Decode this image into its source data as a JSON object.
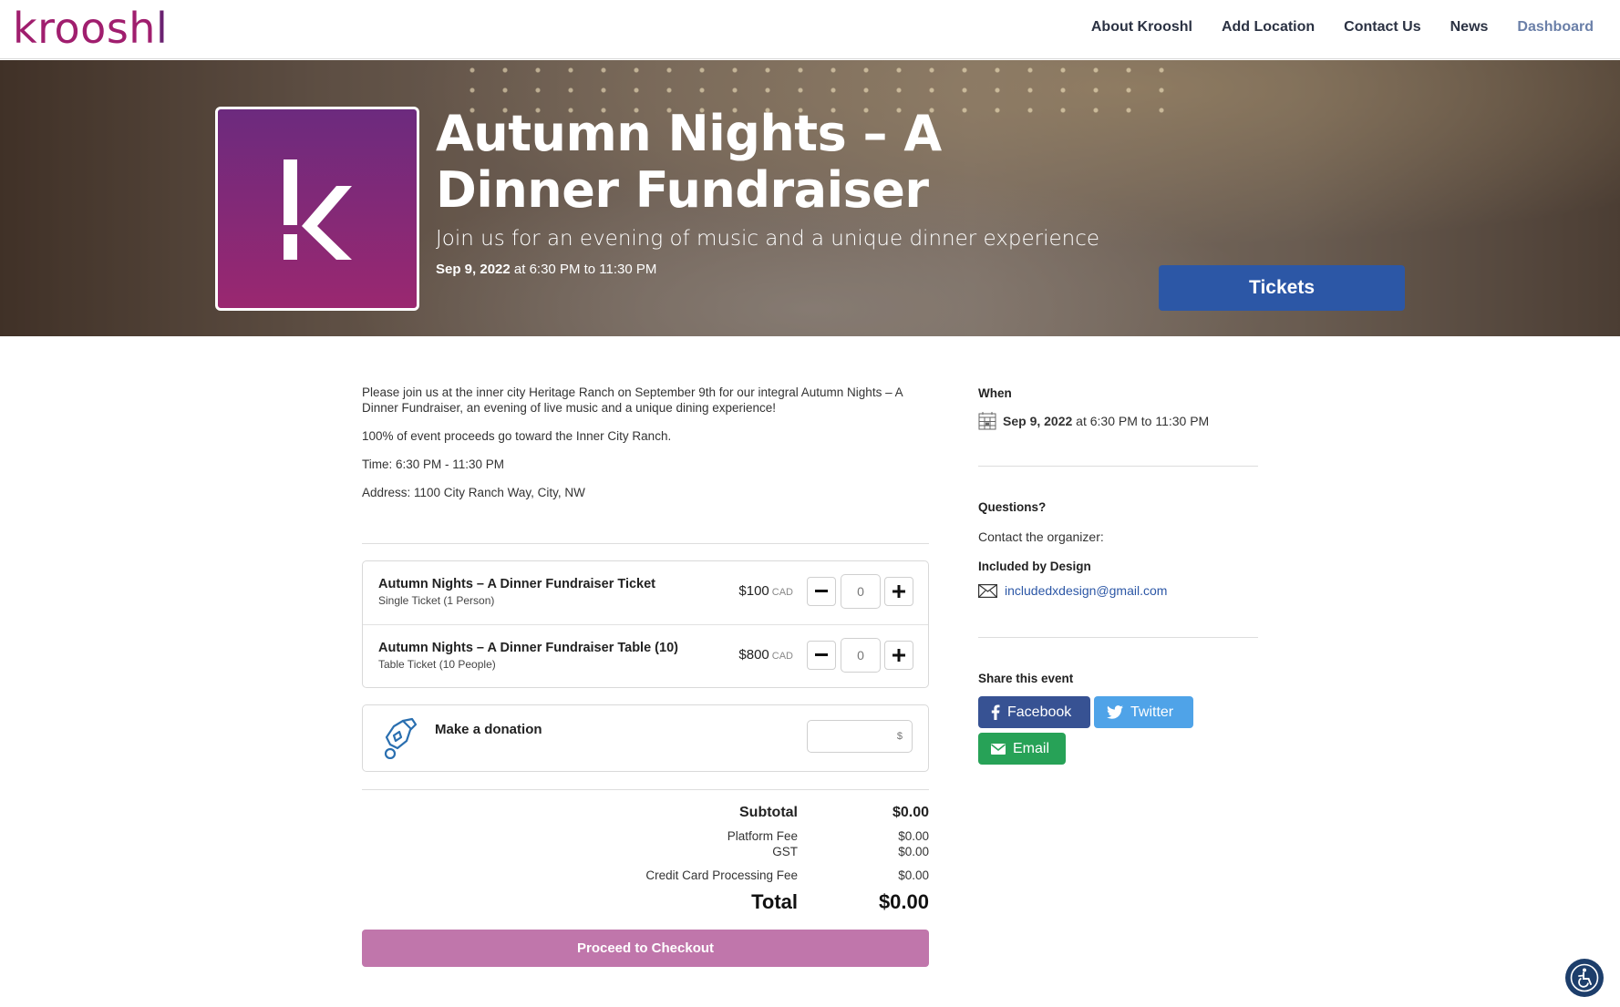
{
  "header": {
    "logo": "kroosh",
    "logo_last": "l",
    "nav": [
      {
        "label": "About Krooshl"
      },
      {
        "label": "Add Location"
      },
      {
        "label": "Contact Us"
      },
      {
        "label": "News"
      },
      {
        "label": "Dashboard"
      }
    ]
  },
  "hero": {
    "title": "Autumn Nights – A Dinner Fundraiser",
    "subtitle": "Join us for an evening of music and a unique dinner experience",
    "date_bold": "Sep 9, 2022",
    "date_rest": " at 6:30 PM to 11:30 PM",
    "tickets_button": "Tickets"
  },
  "description": {
    "paragraphs": [
      "Please join us at the inner city Heritage Ranch on September 9th for our integral Autumn Nights – A Dinner Fundraiser, an evening of live music and a unique dining experience!",
      "100% of event proceeds go toward the Inner City Ranch.",
      "Time: 6:30 PM - 11:30 PM",
      "Address: 1100 City Ranch Way, City, NW"
    ]
  },
  "tickets": [
    {
      "name": "Autumn Nights – A Dinner Fundraiser Ticket",
      "sub": "Single Ticket (1 Person)",
      "price": "$100",
      "currency": "CAD",
      "quantity": "0"
    },
    {
      "name": "Autumn Nights – A Dinner Fundraiser Table (10)",
      "sub": "Table Ticket (10 People)",
      "price": "$800",
      "currency": "CAD",
      "quantity": "0"
    }
  ],
  "donation": {
    "label": "Make a donation",
    "placeholder": "$"
  },
  "totals": {
    "subtotal_label": "Subtotal",
    "subtotal": "$0.00",
    "platform_fee_label": "Platform Fee",
    "platform_fee": "$0.00",
    "gst_label": "GST",
    "gst": "$0.00",
    "cc_fee_label": "Credit Card Processing Fee",
    "cc_fee": "$0.00",
    "total_label": "Total",
    "total": "$0.00"
  },
  "checkout_button": "Proceed to Checkout",
  "sidebar": {
    "when_heading": "When",
    "when_date_bold": "Sep 9, 2022",
    "when_date_rest": " at 6:30 PM to 11:30 PM",
    "questions_heading": "Questions?",
    "contact_text": "Contact the organizer:",
    "organizer_name": "Included by Design",
    "organizer_email": "includedxdesign@gmail.com",
    "share_heading": "Share this event",
    "share": {
      "facebook": "Facebook",
      "twitter": "Twitter",
      "email": "Email"
    }
  },
  "colors": {
    "brand_purple": "#6a2271",
    "tickets_blue": "#2c57a6",
    "checkout_pink": "#c076ab",
    "facebook": "#375293",
    "twitter": "#4fa3e8",
    "email": "#27a257"
  }
}
